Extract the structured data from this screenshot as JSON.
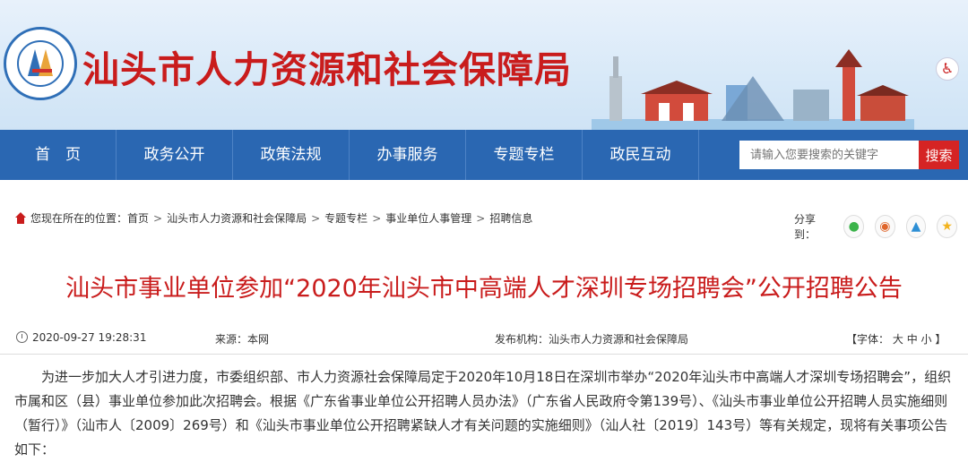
{
  "site": {
    "title": "汕头市人力资源和社会保障局",
    "accessibility_icon": "wheelchair-icon"
  },
  "nav": {
    "items": [
      "首　页",
      "政务公开",
      "政策法规",
      "办事服务",
      "专题专栏",
      "政民互动"
    ],
    "search_placeholder": "请输入您要搜索的关键字",
    "search_label": "搜索"
  },
  "breadcrumb": {
    "prefix": "您现在所在的位置：",
    "items": [
      "首页",
      "汕头市人力资源和社会保障局",
      "专题专栏",
      "事业单位人事管理",
      "招聘信息"
    ],
    "separator": ">"
  },
  "share": {
    "label": "分享到：",
    "icons": [
      "wechat-icon",
      "weibo-icon",
      "qq-icon",
      "qzone-icon"
    ]
  },
  "article": {
    "title": "汕头市事业单位参加“2020年汕头市中高端人才深圳专场招聘会”公开招聘公告",
    "date": "2020-09-27 19:28:31",
    "source_label": "来源：",
    "source": "本网",
    "publisher_label": "发布机构：",
    "publisher": "汕头市人力资源和社会保障局",
    "font_size_label": "【字体：",
    "font_large": "大",
    "font_medium": "中",
    "font_small": "小",
    "font_close": "】",
    "body": "为进一步加大人才引进力度，市委组织部、市人力资源社会保障局定于2020年10月18日在深圳市举办“2020年汕头市中高端人才深圳专场招聘会”，组织市属和区（县）事业单位参加此次招聘会。根据《广东省事业单位公开招聘人员办法》（广东省人民政府令第139号）、《汕头市事业单位公开招聘人员实施细则（暂行）》（汕市人〔2009〕269号）和《汕头市事业单位公开招聘紧缺人才有关问题的实施细则》（汕人社〔2019〕143号）等有关规定，现将有关事项公告如下："
  },
  "colors": {
    "brand_red": "#c91c1c",
    "nav_blue": "#2a67b2",
    "search_red": "#d52424"
  }
}
